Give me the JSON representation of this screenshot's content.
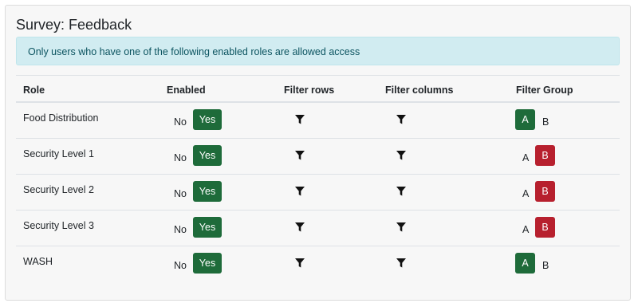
{
  "panel": {
    "title": "Survey: Feedback",
    "notice": "Only users who have one of the following enabled roles are allowed access"
  },
  "table": {
    "headers": {
      "role": "Role",
      "enabled": "Enabled",
      "filter_rows": "Filter rows",
      "filter_columns": "Filter columns",
      "filter_group": "Filter Group"
    },
    "rows": [
      {
        "role": "Food Distribution",
        "no_label": "No",
        "yes_label": "Yes",
        "group_a": "A",
        "group_b": "B",
        "selected_group": "A"
      },
      {
        "role": "Security Level 1",
        "no_label": "No",
        "yes_label": "Yes",
        "group_a": "A",
        "group_b": "B",
        "selected_group": "B"
      },
      {
        "role": "Security Level 2",
        "no_label": "No",
        "yes_label": "Yes",
        "group_a": "A",
        "group_b": "B",
        "selected_group": "B"
      },
      {
        "role": "Security Level 3",
        "no_label": "No",
        "yes_label": "Yes",
        "group_a": "A",
        "group_b": "B",
        "selected_group": "B"
      },
      {
        "role": "WASH",
        "no_label": "No",
        "yes_label": "Yes",
        "group_a": "A",
        "group_b": "B",
        "selected_group": "A"
      }
    ]
  },
  "icons": {
    "filter": "filter-funnel-icon"
  },
  "colors": {
    "enabled_green": "#1e6b3a",
    "group_b_red": "#b7202e",
    "alert_bg": "#d1ecf1",
    "alert_text": "#0c5460"
  }
}
